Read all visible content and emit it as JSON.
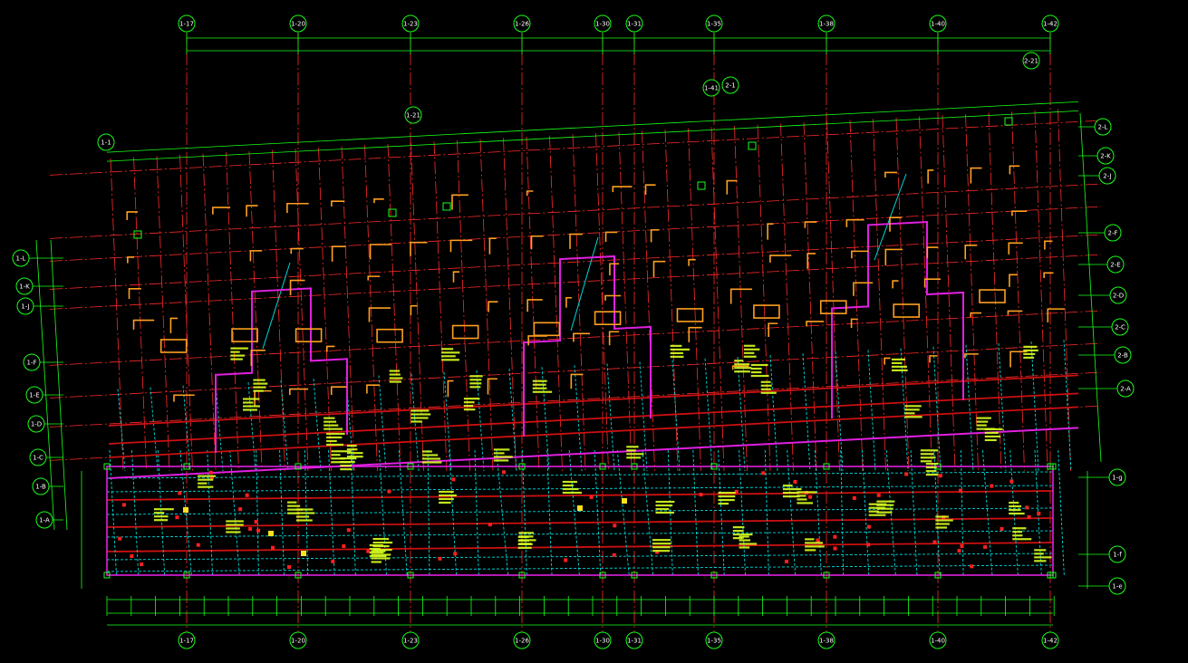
{
  "drawing": {
    "colors": {
      "background": "#000000",
      "grid_line": "#ff2a2a",
      "dimension": "#19ff19",
      "wall": "#e020e0",
      "column": "#ffa020",
      "beam": "#00d8d8",
      "beam_heavy": "#cc1010",
      "annotation": "#e8ff30"
    },
    "top_axes": [
      "1-17",
      "1-20",
      "1-23",
      "1-26",
      "1-30",
      "1-31",
      "1-35",
      "1-38",
      "1-40",
      "1-42"
    ],
    "bottom_axes": [
      "1-17",
      "1-20",
      "1-23",
      "1-26",
      "1-30",
      "1-31",
      "1-35",
      "1-38",
      "1-40",
      "1-42"
    ],
    "left_axes": [
      "1-L",
      "1-K",
      "1-J",
      "1-F",
      "1-E",
      "1-D",
      "1-C",
      "1-B",
      "1-A"
    ],
    "right_axes": [
      "2-L",
      "2-K",
      "2-J",
      "2-F",
      "2-E",
      "2-D",
      "2-C",
      "2-B",
      "2-A",
      "1-g",
      "1-f",
      "1-e"
    ],
    "slanted_axes": [
      "1-1",
      "1-21",
      "1-41",
      "2-1",
      "2-21"
    ]
  }
}
